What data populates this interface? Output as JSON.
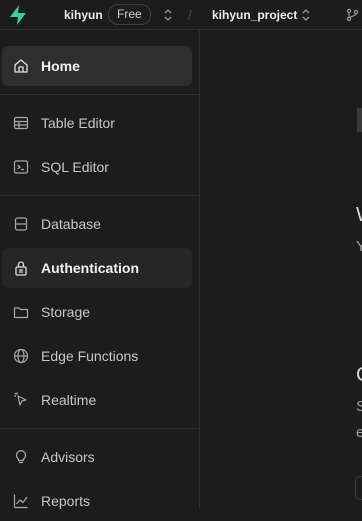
{
  "topbar": {
    "org_name": "kihyun",
    "plan": "Free",
    "separator": "/",
    "project_name": "kihyun_project"
  },
  "sidebar": {
    "items": [
      {
        "label": "Home",
        "icon": "home-icon",
        "state": "active"
      },
      {
        "label": "Table Editor",
        "icon": "table-icon"
      },
      {
        "label": "SQL Editor",
        "icon": "terminal-icon"
      },
      {
        "label": "Database",
        "icon": "database-icon"
      },
      {
        "label": "Authentication",
        "icon": "lock-icon",
        "state": "hover"
      },
      {
        "label": "Storage",
        "icon": "folder-icon"
      },
      {
        "label": "Edge Functions",
        "icon": "globe-icon"
      },
      {
        "label": "Realtime",
        "icon": "cursor-icon"
      },
      {
        "label": "Advisors",
        "icon": "lightbulb-icon"
      },
      {
        "label": "Reports",
        "icon": "chart-icon"
      }
    ]
  },
  "main": {
    "fragments": [
      "W",
      "Y",
      "C",
      "S",
      "e"
    ]
  },
  "colors": {
    "brand": "#3ecf8e",
    "background": "#1c1c1c",
    "active_item": "#2e2e2e"
  }
}
